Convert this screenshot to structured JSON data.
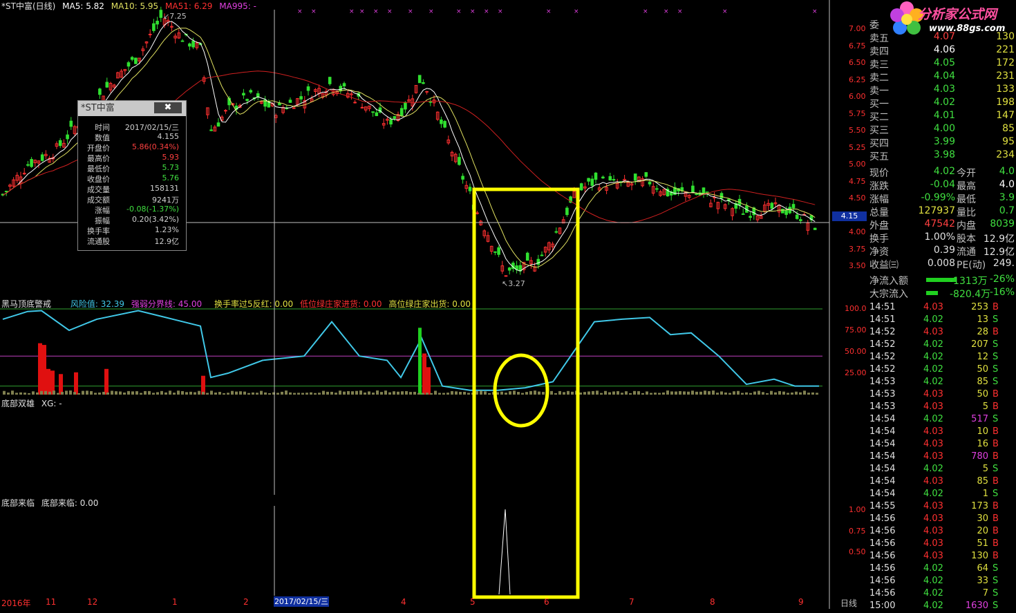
{
  "main_header": {
    "title": "*ST中富(日线)",
    "ma5": "MA5: 5.82",
    "ma10": "MA10: 5.95",
    "ma51": "MA51: 6.29",
    "ma995": "MA995: -"
  },
  "price_axis": [
    "7.00",
    "6.75",
    "6.50",
    "6.25",
    "6.00",
    "5.75",
    "5.50",
    "5.25",
    "5.00",
    "4.75",
    "4.50",
    "4.25",
    "4.00",
    "3.75",
    "3.50"
  ],
  "current_price_tag": "4.15",
  "high_marker": "7.25",
  "low_marker": "3.27",
  "indicator1": {
    "name": "黑马顶底警戒",
    "risk": "风险值: 32.39",
    "boundary": "强弱分界线: 45.00",
    "turnover": "换手率过5反红: 0.00",
    "low_green": "低位绿庄家进货: 0.00",
    "high_green": "高位绿庄家出货: 0.00",
    "axis": [
      "100.0",
      "75.00",
      "50.00",
      "25.00"
    ]
  },
  "indicator2": {
    "name": "底部双雄",
    "value": "XG: -"
  },
  "indicator3": {
    "name": "底部来临",
    "value": "底部来临: 0.00",
    "axis": [
      "1.00",
      "0.75",
      "0.50"
    ]
  },
  "date_axis": {
    "year": "2016年",
    "labels": [
      "11",
      "12",
      "1",
      "2",
      "4",
      "5",
      "6",
      "7",
      "8",
      "9"
    ],
    "cursor_date": "2017/02/15/三",
    "period": "日线"
  },
  "info_popup": {
    "title": "*ST中富",
    "close": "✖",
    "rows": [
      {
        "k": "时间",
        "v": "2017/02/15/三",
        "c": "#d0d0d0"
      },
      {
        "k": "数值",
        "v": "4.155",
        "c": "#d0d0d0"
      },
      {
        "k": "开盘价",
        "v": "5.86(0.34%)",
        "c": "#ff4040"
      },
      {
        "k": "最高价",
        "v": "5.93",
        "c": "#ff4040"
      },
      {
        "k": "最低价",
        "v": "5.73",
        "c": "#40e040"
      },
      {
        "k": "收盘价",
        "v": "5.76",
        "c": "#40e040"
      },
      {
        "k": "成交量",
        "v": "158131",
        "c": "#d0d0d0"
      },
      {
        "k": "成交额",
        "v": "9241万",
        "c": "#d0d0d0"
      },
      {
        "k": "涨幅",
        "v": "-0.08(-1.37%)",
        "c": "#40e040"
      },
      {
        "k": "振幅",
        "v": "0.20(3.42%)",
        "c": "#d0d0d0"
      },
      {
        "k": "换手率",
        "v": "1.23%",
        "c": "#d0d0d0"
      },
      {
        "k": "流通股",
        "v": "12.9亿",
        "c": "#d0d0d0"
      }
    ]
  },
  "logo": {
    "title": "分析家公式网",
    "url": "www.88gs.com"
  },
  "order_book": [
    {
      "l": "委",
      "v": "",
      "q": "",
      "vc": "#c0c0c0"
    },
    {
      "l": "卖五",
      "v": "4.07",
      "q": "130",
      "vc": "#ff4040"
    },
    {
      "l": "卖四",
      "v": "4.06",
      "q": "221",
      "vc": "#ffffff"
    },
    {
      "l": "卖三",
      "v": "4.05",
      "q": "172",
      "vc": "#40e040"
    },
    {
      "l": "卖二",
      "v": "4.04",
      "q": "231",
      "vc": "#40e040"
    },
    {
      "l": "卖一",
      "v": "4.03",
      "q": "133",
      "vc": "#40e040"
    },
    {
      "l": "买一",
      "v": "4.02",
      "q": "198",
      "vc": "#40e040"
    },
    {
      "l": "买二",
      "v": "4.01",
      "q": "147",
      "vc": "#40e040"
    },
    {
      "l": "买三",
      "v": "4.00",
      "q": "85",
      "vc": "#40e040"
    },
    {
      "l": "买四",
      "v": "3.99",
      "q": "95",
      "vc": "#40e040"
    },
    {
      "l": "买五",
      "v": "3.98",
      "q": "234",
      "vc": "#40e040"
    }
  ],
  "quote": [
    {
      "l": "现价",
      "v": "4.02",
      "vc": "#40e040",
      "l2": "今开",
      "v2": "4.0",
      "v2c": "#40e040"
    },
    {
      "l": "涨跌",
      "v": "-0.04",
      "vc": "#40e040",
      "l2": "最高",
      "v2": "4.0",
      "v2c": "#ffffff"
    },
    {
      "l": "涨幅",
      "v": "-0.99%",
      "vc": "#40e040",
      "l2": "最低",
      "v2": "3.9",
      "v2c": "#40e040"
    },
    {
      "l": "总量",
      "v": "127937",
      "vc": "#e0e040",
      "l2": "量比",
      "v2": "0.7",
      "v2c": "#40e040"
    },
    {
      "l": "外盘",
      "v": "47542",
      "vc": "#ff4040",
      "l2": "内盘",
      "v2": "8039",
      "v2c": "#40e040"
    },
    {
      "l": "换手",
      "v": "1.00%",
      "vc": "#e0e0e0",
      "l2": "股本",
      "v2": "12.9亿",
      "v2c": "#e0e0e0"
    },
    {
      "l": "净资",
      "v": "0.39",
      "vc": "#e0e0e0",
      "l2": "流通",
      "v2": "12.9亿",
      "v2c": "#e0e0e0"
    },
    {
      "l": "收益㈢",
      "v": "0.008",
      "vc": "#e0e0e0",
      "l2": "PE(动)",
      "v2": "249.",
      "v2c": "#e0e0e0"
    }
  ],
  "flows": [
    {
      "l": "净流入额",
      "v": "-1313万",
      "p": "-26%",
      "bar": 80
    },
    {
      "l": "大宗流入",
      "v": "-820.4万",
      "p": "-16%",
      "bar": 30
    }
  ],
  "ticks": [
    {
      "t": "14:51",
      "p": "4.03",
      "v": "253",
      "bs": "B"
    },
    {
      "t": "14:51",
      "p": "4.02",
      "v": "13",
      "bs": "S"
    },
    {
      "t": "14:52",
      "p": "4.03",
      "v": "28",
      "bs": "B"
    },
    {
      "t": "14:52",
      "p": "4.02",
      "v": "207",
      "bs": "S"
    },
    {
      "t": "14:52",
      "p": "4.02",
      "v": "12",
      "bs": "S"
    },
    {
      "t": "14:52",
      "p": "4.02",
      "v": "50",
      "bs": "S"
    },
    {
      "t": "14:53",
      "p": "4.02",
      "v": "85",
      "bs": "S"
    },
    {
      "t": "14:53",
      "p": "4.03",
      "v": "50",
      "bs": "B"
    },
    {
      "t": "14:53",
      "p": "4.03",
      "v": "5",
      "bs": "B"
    },
    {
      "t": "14:54",
      "p": "4.02",
      "v": "517",
      "bs": "S"
    },
    {
      "t": "14:54",
      "p": "4.03",
      "v": "10",
      "bs": "B"
    },
    {
      "t": "14:54",
      "p": "4.03",
      "v": "16",
      "bs": "B"
    },
    {
      "t": "14:54",
      "p": "4.03",
      "v": "780",
      "bs": "B"
    },
    {
      "t": "14:54",
      "p": "4.02",
      "v": "5",
      "bs": "S"
    },
    {
      "t": "14:54",
      "p": "4.03",
      "v": "85",
      "bs": "B"
    },
    {
      "t": "14:54",
      "p": "4.02",
      "v": "1",
      "bs": "S"
    },
    {
      "t": "14:55",
      "p": "4.03",
      "v": "173",
      "bs": "B"
    },
    {
      "t": "14:56",
      "p": "4.03",
      "v": "30",
      "bs": "B"
    },
    {
      "t": "14:56",
      "p": "4.03",
      "v": "20",
      "bs": "B"
    },
    {
      "t": "14:56",
      "p": "4.03",
      "v": "51",
      "bs": "B"
    },
    {
      "t": "14:56",
      "p": "4.03",
      "v": "130",
      "bs": "B"
    },
    {
      "t": "14:56",
      "p": "4.02",
      "v": "64",
      "bs": "S"
    },
    {
      "t": "14:56",
      "p": "4.02",
      "v": "33",
      "bs": "S"
    },
    {
      "t": "14:56",
      "p": "4.02",
      "v": "7",
      "bs": "S"
    },
    {
      "t": "15:00",
      "p": "4.02",
      "v": "1630",
      "bs": "S"
    }
  ],
  "colors": {
    "up": "#ff3030",
    "down": "#30e030",
    "ma5": "#ffffff",
    "ma10": "#e0e060",
    "ma51": "#d02020",
    "highlight": "#ffff00",
    "risk_line": "#40c8e8"
  }
}
